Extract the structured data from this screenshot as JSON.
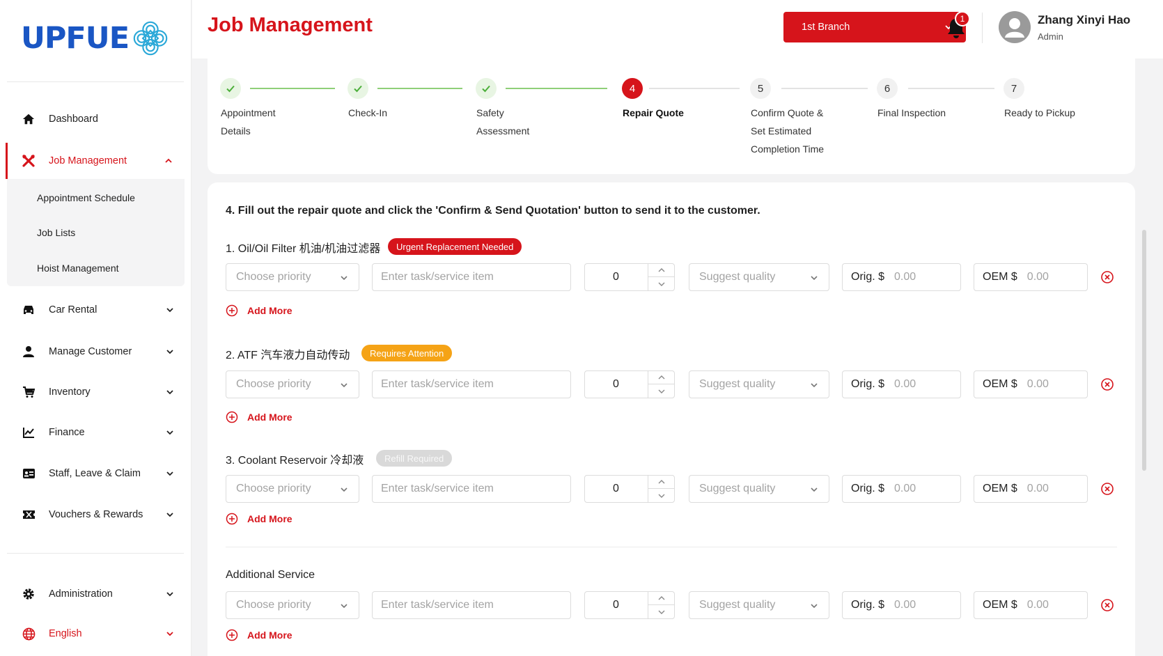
{
  "brand": {
    "name": "UPFUE"
  },
  "header": {
    "title": "Job Management",
    "branch": "1st Branch",
    "notifications": "1",
    "user_name": "Zhang Xinyi Hao",
    "user_role": "Admin"
  },
  "sidebar": {
    "dashboard": "Dashboard",
    "job_management": "Job Management",
    "sub": [
      "Appointment Schedule",
      "Job Lists",
      "Hoist Management"
    ],
    "car_rental": "Car Rental",
    "manage_customer": "Manage Customer",
    "inventory": "Inventory",
    "finance": "Finance",
    "staff": "Staff, Leave & Claim",
    "vouchers": "Vouchers & Rewards",
    "administration": "Administration",
    "language": "English"
  },
  "steps": [
    {
      "num": "1",
      "label1": "Appointment",
      "label2": "Details",
      "label3": "",
      "state": "done"
    },
    {
      "num": "2",
      "label1": "Check-In",
      "label2": "",
      "label3": "",
      "state": "done"
    },
    {
      "num": "3",
      "label1": "Safety",
      "label2": "Assessment",
      "label3": "",
      "state": "done"
    },
    {
      "num": "4",
      "label1": "Repair Quote",
      "label2": "",
      "label3": "",
      "state": "current"
    },
    {
      "num": "5",
      "label1": "Confirm Quote &",
      "label2": "Set Estimated",
      "label3": "Completion Time",
      "state": "todo"
    },
    {
      "num": "6",
      "label1": "Final Inspection",
      "label2": "",
      "label3": "",
      "state": "todo"
    },
    {
      "num": "7",
      "label1": "Ready to Pickup",
      "label2": "",
      "label3": "",
      "state": "todo"
    }
  ],
  "form": {
    "instruction": "4. Fill out the repair quote and click the 'Confirm & Send Quotation' button to send it to the customer.",
    "priority_placeholder": "Choose priority",
    "task_placeholder": "Enter task/service item",
    "qty_value": "0",
    "quality_placeholder": "Suggest quality",
    "orig_prefix": "Orig. $",
    "oem_prefix": "OEM $",
    "price_placeholder": "0.00",
    "add_more": "Add More",
    "items": [
      {
        "title": "1. Oil/Oil Filter 机油/机油过滤器",
        "tag": "Urgent Replacement Needed",
        "tag_color": "#d6141b"
      },
      {
        "title": "2. ATF  汽车液力自动传动",
        "tag": "Requires Attention",
        "tag_color": "#f5a316"
      },
      {
        "title": "3. Coolant Reservoir 冷却液",
        "tag": "Refill Required",
        "tag_color": "#d9d9d9"
      }
    ],
    "additional_title": "Additional Service"
  },
  "colors": {
    "accent": "#d6141b",
    "brand_blue": "#1a56c4",
    "step_done": "#8fcf78",
    "warning": "#f5a316"
  }
}
